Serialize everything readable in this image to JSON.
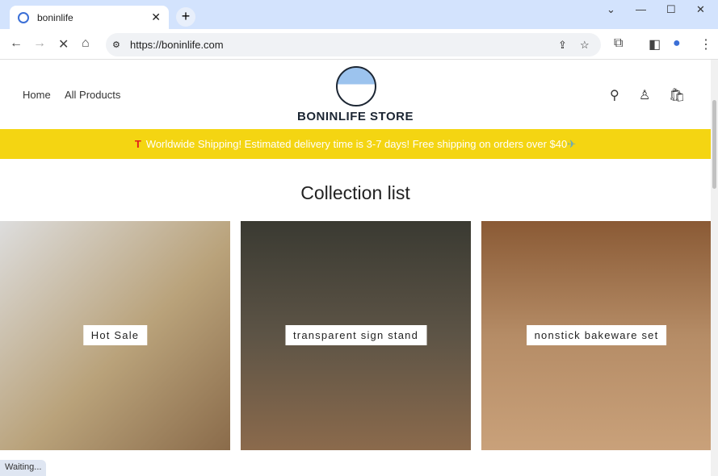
{
  "browser": {
    "tab_title": "boninlife",
    "url": "https://boninlife.com",
    "status": "Waiting..."
  },
  "header": {
    "nav": [
      "Home",
      "All Products"
    ],
    "brand": "BONINLIFE STORE"
  },
  "banner": {
    "text": "Worldwide Shipping! Estimated delivery time is 3-7 days! Free shipping on orders over $40",
    "icon": "T",
    "trailing_icon": "✈"
  },
  "main": {
    "title": "Collection list",
    "collections": [
      {
        "label": "Hot Sale"
      },
      {
        "label": "transparent sign stand"
      },
      {
        "label": "nonstick bakeware set"
      }
    ]
  }
}
